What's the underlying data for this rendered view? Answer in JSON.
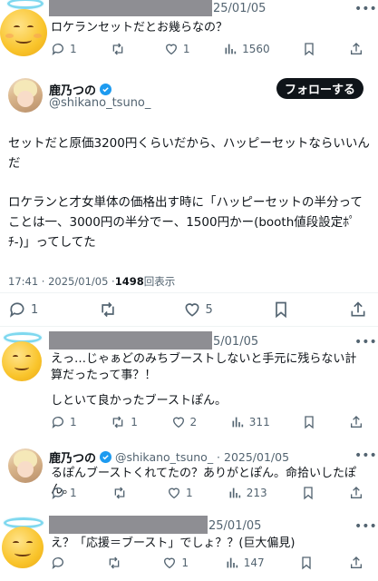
{
  "reply1": {
    "date_fragment": "25/01/05",
    "text": "ロケランセットだとお幾らなの？",
    "stats": {
      "replies": "1",
      "retweets": "",
      "likes": "1",
      "views": "1560"
    }
  },
  "main": {
    "display_name": "鹿乃つの",
    "handle": "@shikano_tsuno_",
    "follow_label": "フォローする",
    "paragraph1": "セットだと原価3200円くらいだから、ハッピーセットならいいんだ",
    "paragraph2": "ロケランと才女単体の価格出す時に「ハッピーセットの半分ってことは一、3000円の半分でー、1500円かー(booth値段設定ﾎﾟﾁ-)」ってしてた",
    "time": "17:41 · 2025/01/05 · ",
    "views_count": "1498",
    "views_label": " 回表示",
    "stats": {
      "replies": "1",
      "retweets": "",
      "likes": "5"
    }
  },
  "reply2": {
    "date_fragment": "5/01/05",
    "text_line1": "えっ…じゃぁどのみちブーストしないと手元に残らない計算だったって事？！",
    "text_line2": "しといて良かったブーストぽん。",
    "stats": {
      "replies": "1",
      "retweets": "1",
      "likes": "2",
      "views": "311"
    }
  },
  "reply3": {
    "display_name": "鹿乃つの",
    "handle_date": "@shikano_tsuno_ · 2025/01/05",
    "text": "るぽんブーストくれてたの？ありがとぽん。命拾いしたぽん。",
    "stats": {
      "replies": "1",
      "retweets": "",
      "likes": "1",
      "views": "213"
    }
  },
  "reply4": {
    "date_fragment": "25/01/05",
    "text": "え？「応援＝ブースト」でしょ？？(巨大偏見)",
    "stats": {
      "replies": "",
      "retweets": "",
      "likes": "1",
      "views": "147"
    }
  },
  "colors": {
    "accent": "#1d9bf0",
    "muted": "#536471",
    "redacted": "#8e8e93"
  }
}
